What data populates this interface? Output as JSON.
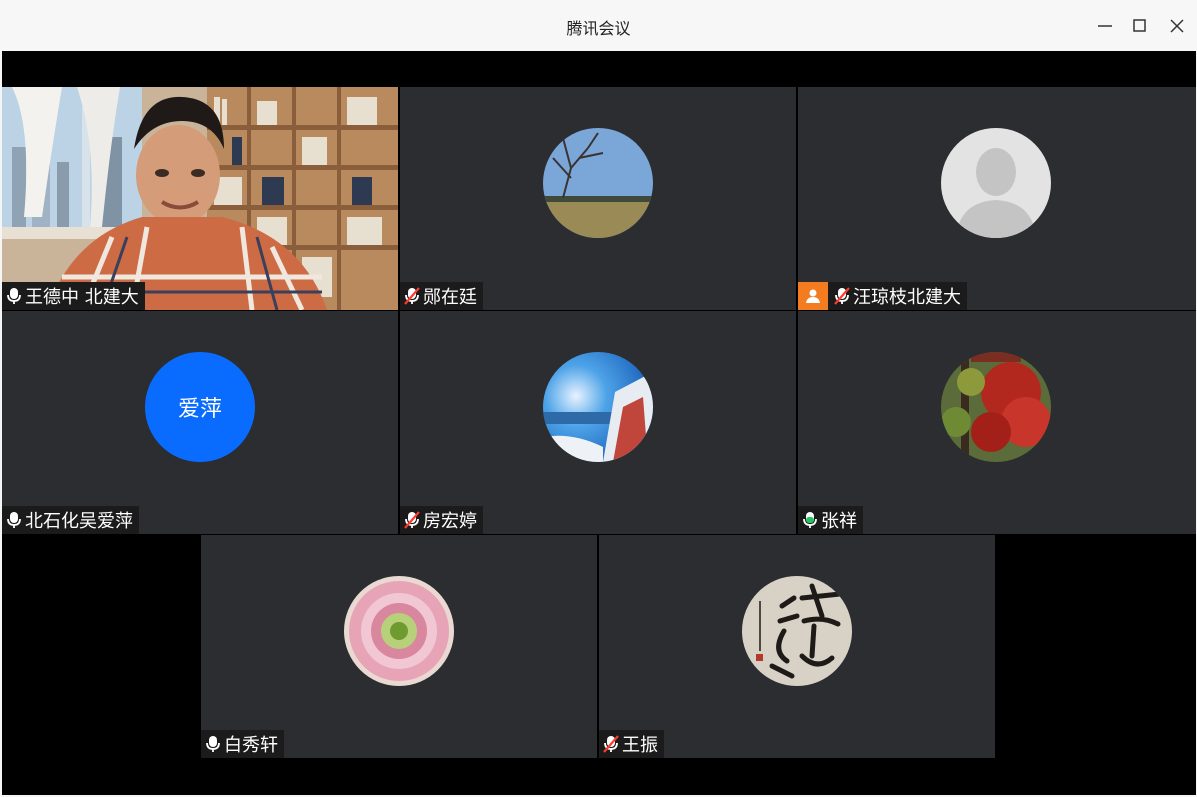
{
  "window": {
    "title": "腾讯会议",
    "controls": [
      "minimize-icon",
      "maximize-icon",
      "close-icon"
    ]
  },
  "participants": [
    {
      "name": "王德中 北建大",
      "mic": "on",
      "avatar": "video-feed"
    },
    {
      "name": "郧在廷",
      "mic": "muted",
      "avatar": "winter-tree-photo"
    },
    {
      "name": "汪琼枝北建大",
      "mic": "muted",
      "avatar": "default-person-icon",
      "badge": "host-icon"
    },
    {
      "name": "北石化吴爱萍",
      "mic": "on",
      "avatar": "initials",
      "initials": "爱萍",
      "avatar_color": "#0a6cff"
    },
    {
      "name": "房宏婷",
      "mic": "muted",
      "avatar": "snow-coast-photo"
    },
    {
      "name": "张祥",
      "mic": "speaking",
      "avatar": "red-maple-photo"
    },
    {
      "name": "白秀轩",
      "mic": "on",
      "avatar": "chrysanthemum-photo"
    },
    {
      "name": "王振",
      "mic": "muted",
      "avatar": "calligraphy-photo"
    }
  ],
  "colors": {
    "tile_bg": "#2b2d31",
    "stage_bg": "#000000",
    "speaking": "#22c55e",
    "muted": "#ff3b30",
    "host_badge": "#f47c20"
  }
}
